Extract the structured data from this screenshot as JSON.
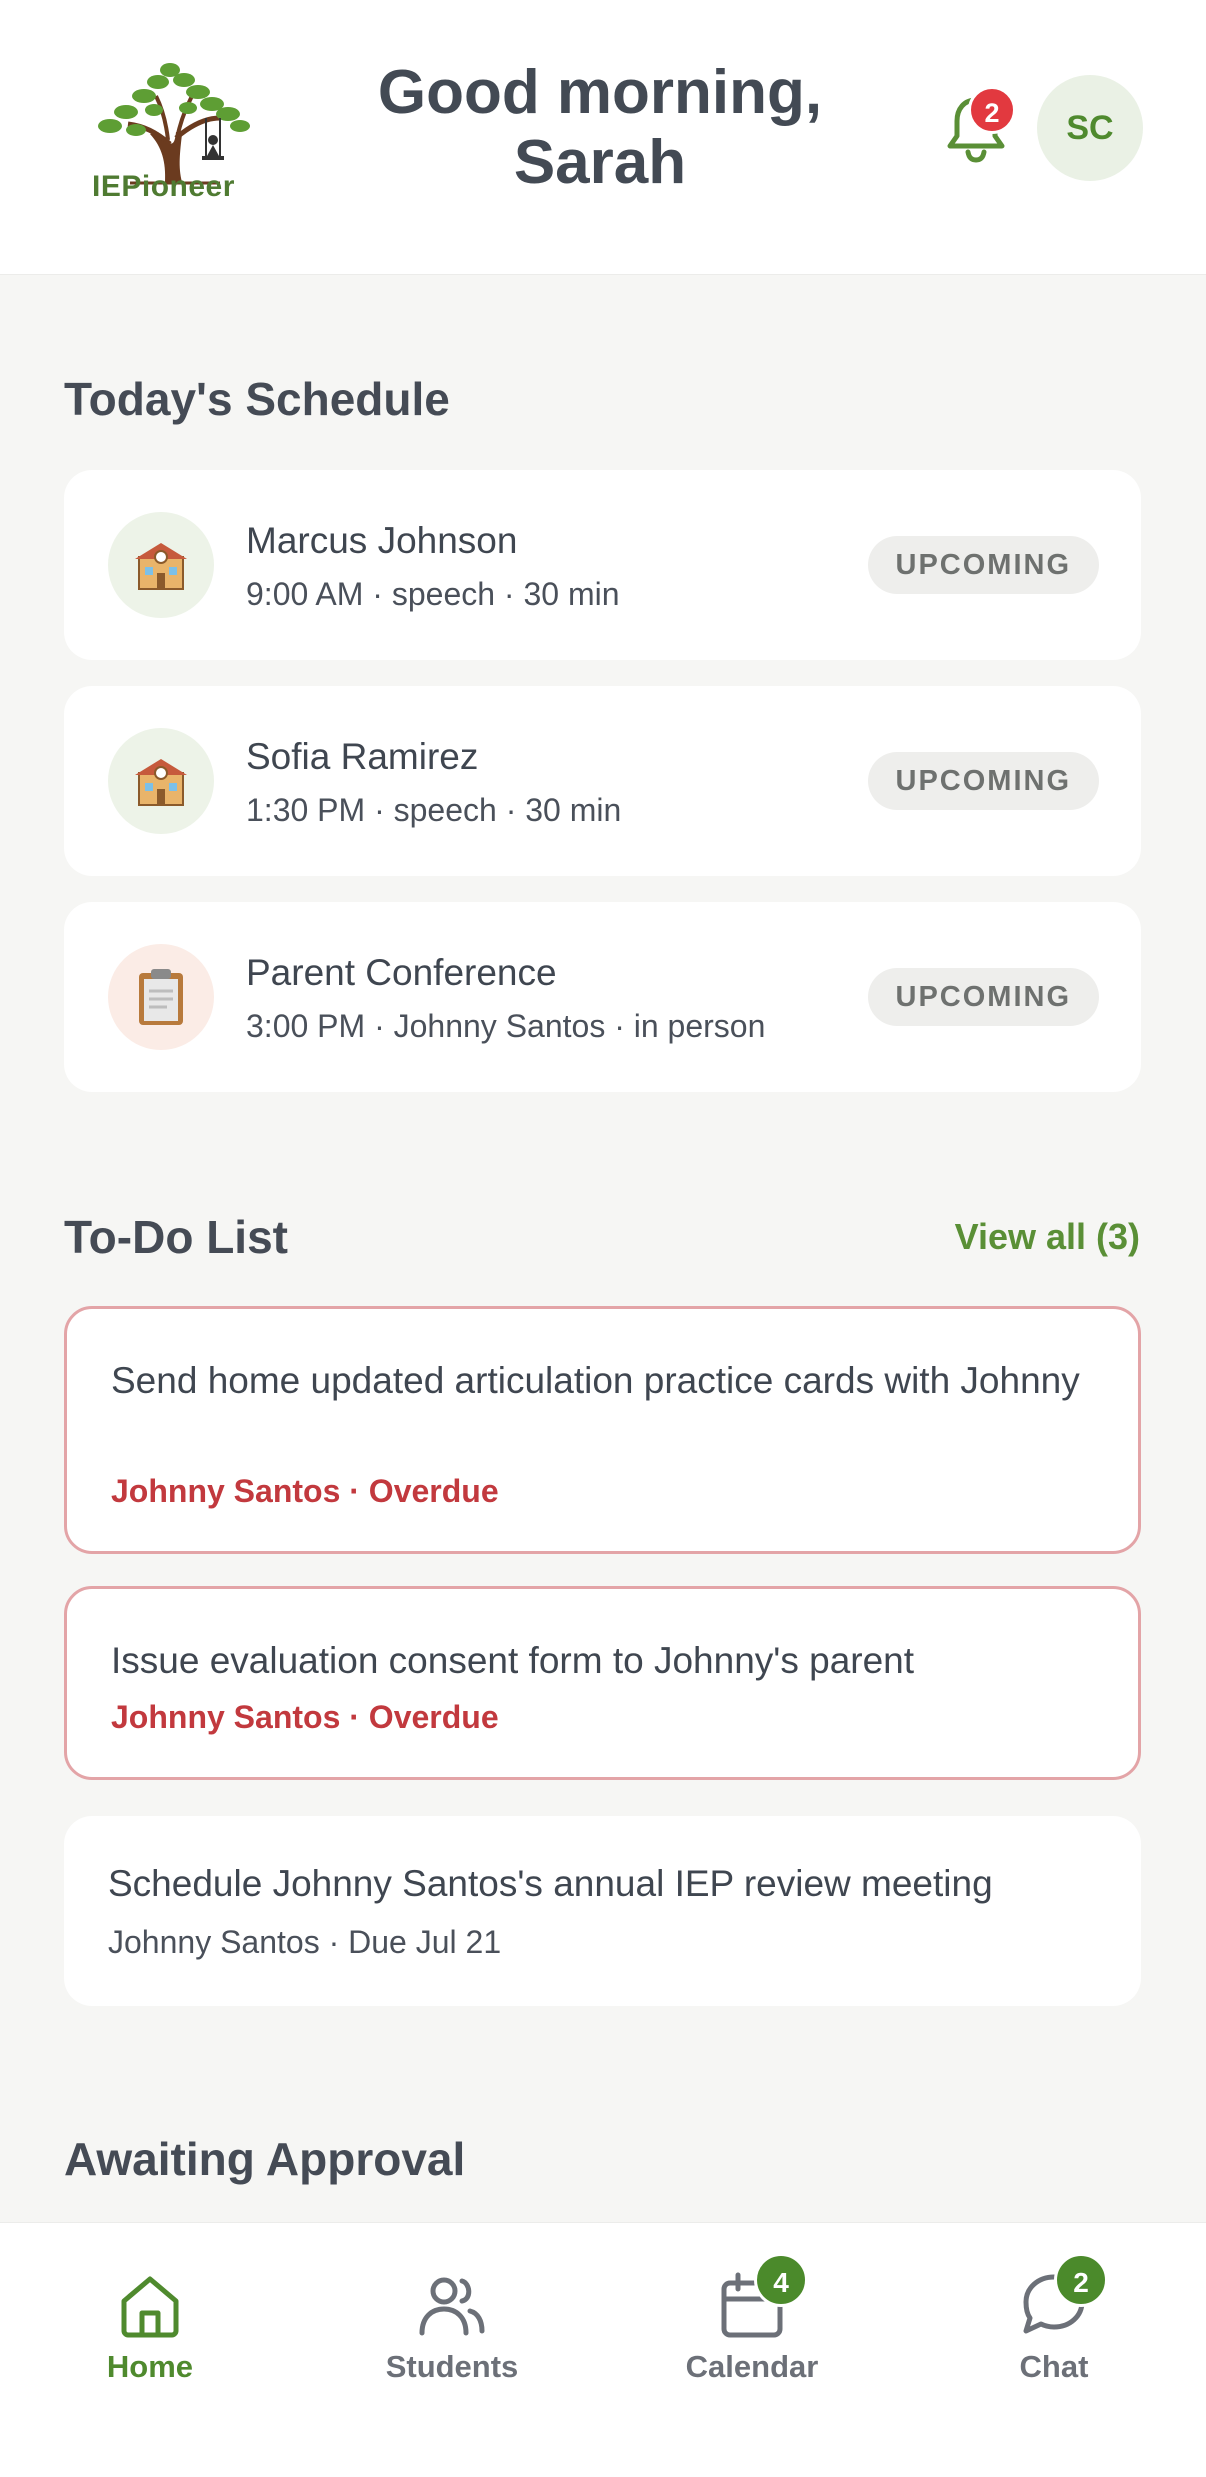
{
  "header": {
    "logo_text": "IEPioneer",
    "greeting": "Good morning, Sarah",
    "notification_count": "2",
    "avatar_initials": "SC"
  },
  "schedule": {
    "title": "Today's Schedule",
    "items": [
      {
        "name": "Marcus Johnson",
        "meta": "9:00 AM · speech · 30 min",
        "status": "UPCOMING",
        "icon": "school-building-icon"
      },
      {
        "name": "Sofia Ramirez",
        "meta": "1:30 PM · speech · 30 min",
        "status": "UPCOMING",
        "icon": "school-building-icon"
      },
      {
        "name": "Parent Conference",
        "meta": "3:00 PM · Johnny Santos · in person",
        "status": "UPCOMING",
        "icon": "clipboard-icon"
      }
    ]
  },
  "todo": {
    "title": "To-Do List",
    "view_all": "View all (3)",
    "items": [
      {
        "text": "Send home updated articulation practice cards with Johnny",
        "meta": "Johnny Santos · Overdue",
        "state": "overdue"
      },
      {
        "text": "Issue evaluation consent form to Johnny's parent",
        "meta": "Johnny Santos · Overdue",
        "state": "overdue"
      },
      {
        "text": "Schedule Johnny Santos's annual IEP review meeting",
        "meta": "Johnny Santos · Due Jul 21",
        "state": "normal"
      }
    ]
  },
  "approval": {
    "title": "Awaiting Approval"
  },
  "nav": {
    "items": [
      {
        "label": "Home",
        "icon": "home-icon",
        "active": true
      },
      {
        "label": "Students",
        "icon": "students-icon"
      },
      {
        "label": "Calendar",
        "icon": "calendar-icon",
        "badge": "4"
      },
      {
        "label": "Chat",
        "icon": "chat-icon",
        "badge": "2"
      }
    ]
  },
  "colors": {
    "brand_green": "#4f8a2e",
    "overdue_red": "#c2393e",
    "badge_red": "#e2393f",
    "background": "#f6f6f4"
  }
}
